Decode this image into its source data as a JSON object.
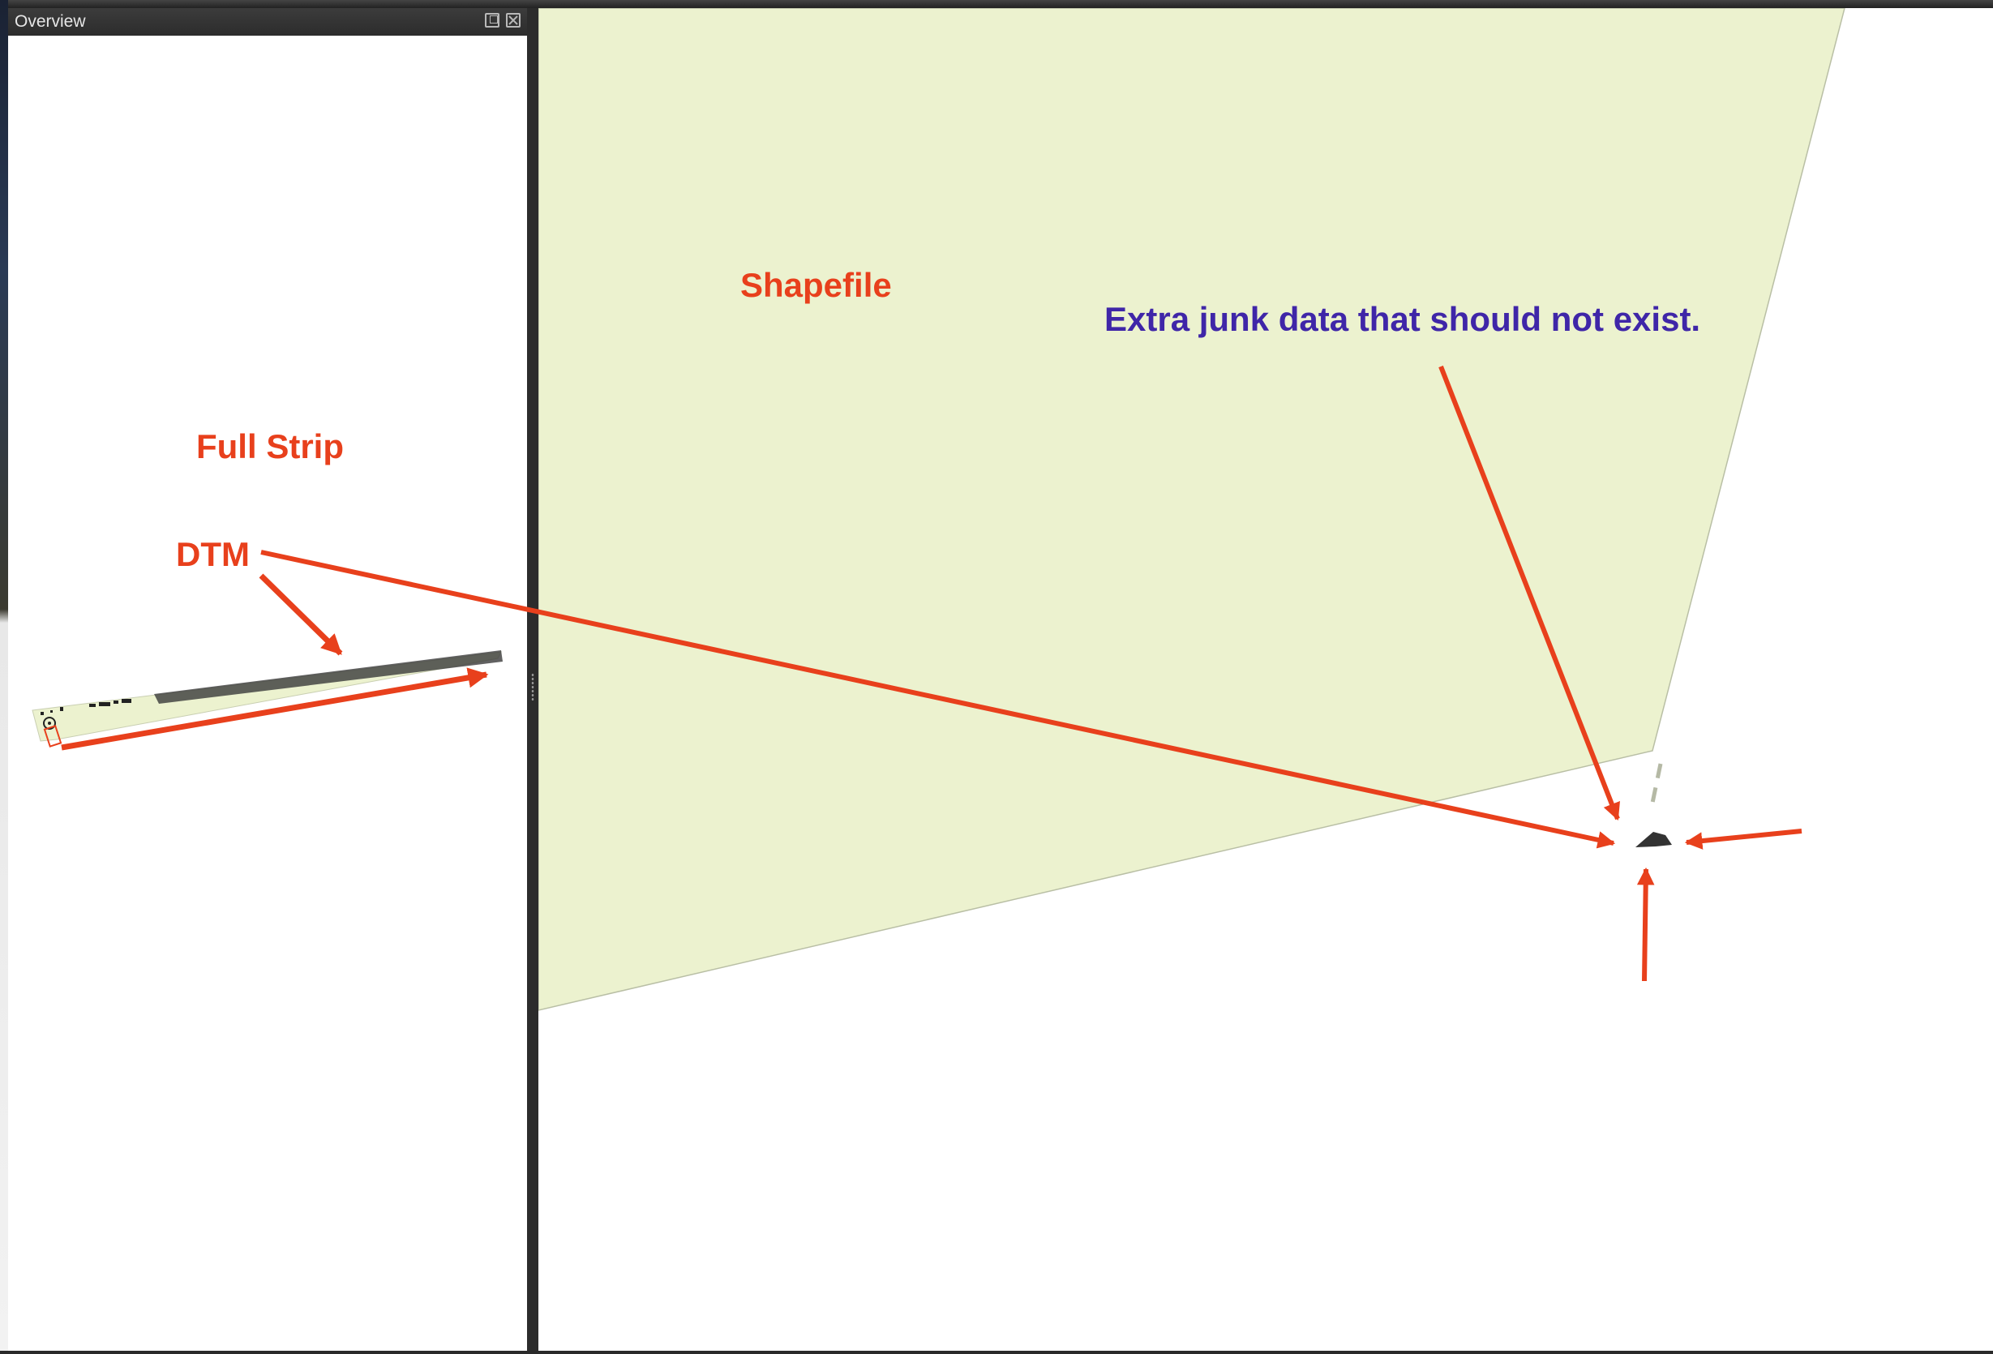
{
  "overview_panel": {
    "title": "Overview",
    "float_button_icon": "float-window-icon",
    "close_button_icon": "close-icon"
  },
  "annotations": {
    "shapefile_label": "Shapefile",
    "junk_label": "Extra junk data that should not exist.",
    "full_strip_label": "Full Strip",
    "dtm_label": "DTM"
  },
  "colors": {
    "annotation_red": "#e8401c",
    "annotation_purple": "#3f26a8",
    "shapefile_fill": "#ecf2cf",
    "panel_titlebar": "#2e2e2e"
  }
}
